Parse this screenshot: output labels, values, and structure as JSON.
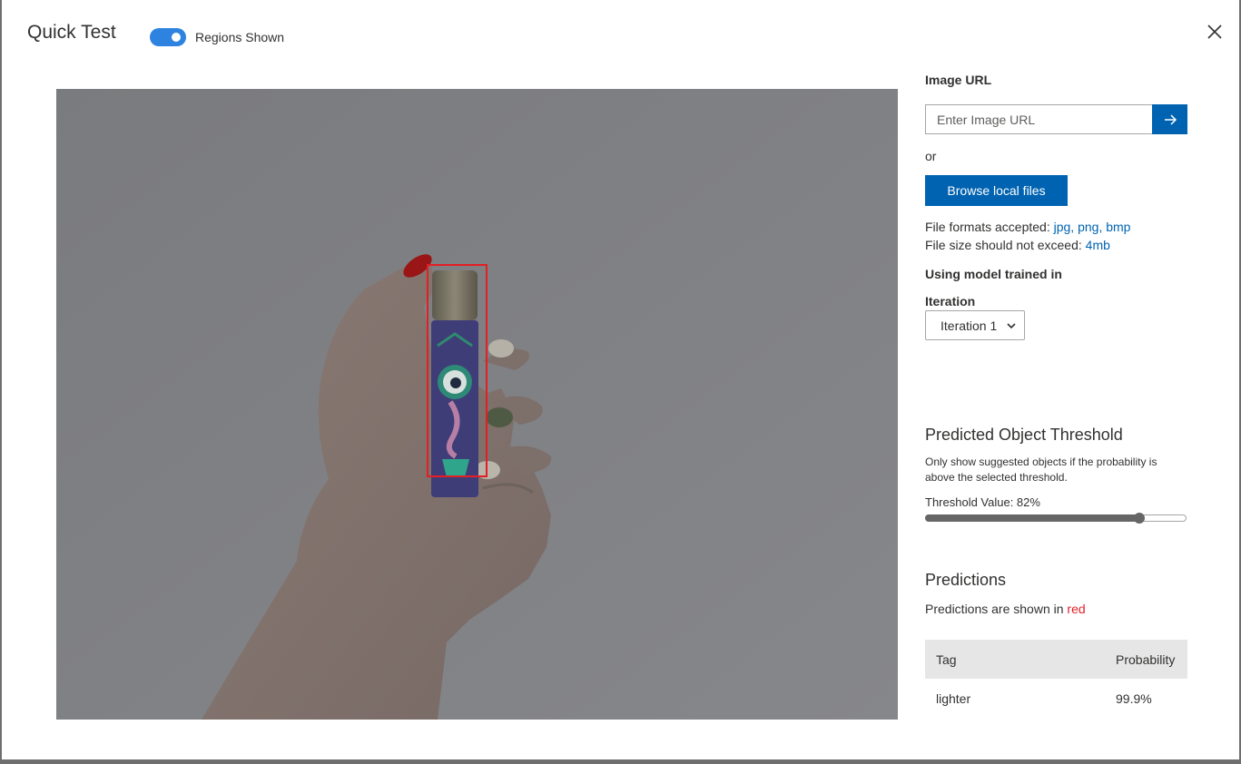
{
  "header": {
    "title": "Quick Test",
    "toggle_label": "Regions Shown",
    "toggle_on": true
  },
  "image_panel": {
    "prediction_box_color": "#e31e24"
  },
  "side": {
    "image_url_label": "Image URL",
    "image_url_placeholder": "Enter Image URL",
    "image_url_value": "",
    "or_text": "or",
    "browse_label": "Browse local files",
    "formats_prefix": "File formats accepted: ",
    "formats_value": "jpg, png, bmp",
    "size_prefix": "File size should not exceed: ",
    "size_value": "4mb",
    "model_heading": "Using model trained in",
    "iteration_label": "Iteration",
    "iteration_selected": "Iteration 1"
  },
  "threshold": {
    "title": "Predicted Object Threshold",
    "description": "Only show suggested objects if the probability is above the selected threshold.",
    "value_label": "Threshold Value: 82%",
    "value": 0.82
  },
  "predictions": {
    "title": "Predictions",
    "note_prefix": "Predictions are shown in ",
    "note_color_word": "red",
    "columns": [
      "Tag",
      "Probability"
    ],
    "rows": [
      {
        "tag": "lighter",
        "probability": "99.9%"
      }
    ]
  },
  "colors": {
    "accent": "#0063b1",
    "toggle": "#2f83e0",
    "prediction": "#e31e24"
  },
  "icons": {
    "close": "close-icon",
    "go": "arrow-right-icon",
    "select": "chevron-down-icon"
  }
}
